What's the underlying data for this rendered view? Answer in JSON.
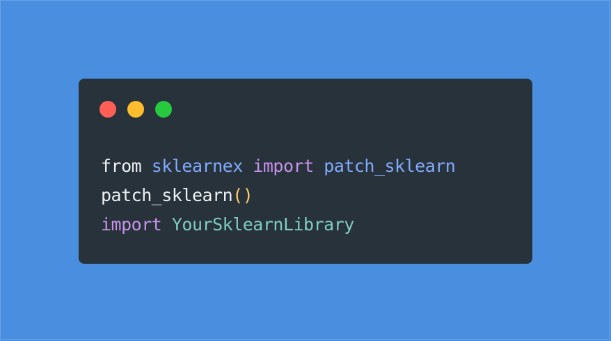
{
  "window_controls": [
    {
      "name": "close",
      "color": "#ff5f56"
    },
    {
      "name": "minimize",
      "color": "#ffbd2e"
    },
    {
      "name": "maximize",
      "color": "#27c93f"
    }
  ],
  "code": {
    "colors": {
      "plain": "#eef1f3",
      "module": "#82aaff",
      "keyword": "#c792ea",
      "paren": "#ffcb6b",
      "library": "#80cbc4"
    },
    "lines": [
      [
        {
          "text": "from",
          "kind": "plain"
        },
        {
          "text": " ",
          "kind": "plain"
        },
        {
          "text": "sklearnex",
          "kind": "module"
        },
        {
          "text": " ",
          "kind": "plain"
        },
        {
          "text": "import",
          "kind": "keyword"
        },
        {
          "text": " ",
          "kind": "plain"
        },
        {
          "text": "patch_sklearn",
          "kind": "module"
        }
      ],
      [
        {
          "text": "patch_sklearn",
          "kind": "plain"
        },
        {
          "text": "()",
          "kind": "paren"
        }
      ],
      [
        {
          "text": "import",
          "kind": "keyword"
        },
        {
          "text": " ",
          "kind": "plain"
        },
        {
          "text": "YourSklearnLibrary",
          "kind": "library"
        }
      ]
    ]
  }
}
